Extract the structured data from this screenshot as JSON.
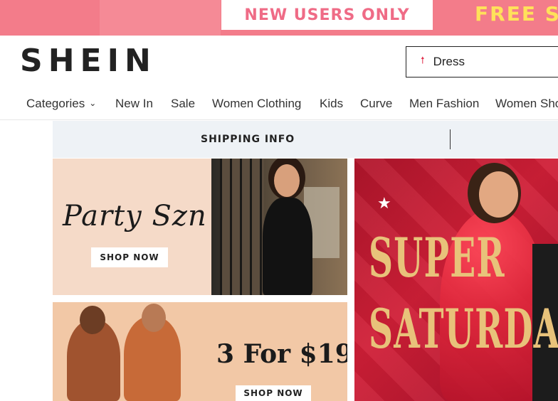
{
  "promo": {
    "new_users": "NEW USERS ONLY",
    "free_text": "FREE S"
  },
  "header": {
    "logo": "SHEIN",
    "search_value": "Dress"
  },
  "nav": {
    "items": [
      {
        "label": "Categories"
      },
      {
        "label": "New In"
      },
      {
        "label": "Sale"
      },
      {
        "label": "Women Clothing"
      },
      {
        "label": "Kids"
      },
      {
        "label": "Curve"
      },
      {
        "label": "Men Fashion"
      },
      {
        "label": "Women Sho"
      }
    ]
  },
  "shipping": {
    "label": "SHIPPING INFO"
  },
  "banners": {
    "party": {
      "title": "Party Szn",
      "button": "SHOP NOW"
    },
    "deal": {
      "title": "3 For $19",
      "button": "SHOP NOW"
    },
    "super": {
      "line1": "SUPER",
      "line2": "SATURDAY"
    }
  },
  "colors": {
    "promo_pink": "#f37c8a",
    "promo_text": "#ef6b86",
    "free_yellow": "#ffe15a",
    "super_red": "#c81a30",
    "gold": "#e8c27a"
  }
}
